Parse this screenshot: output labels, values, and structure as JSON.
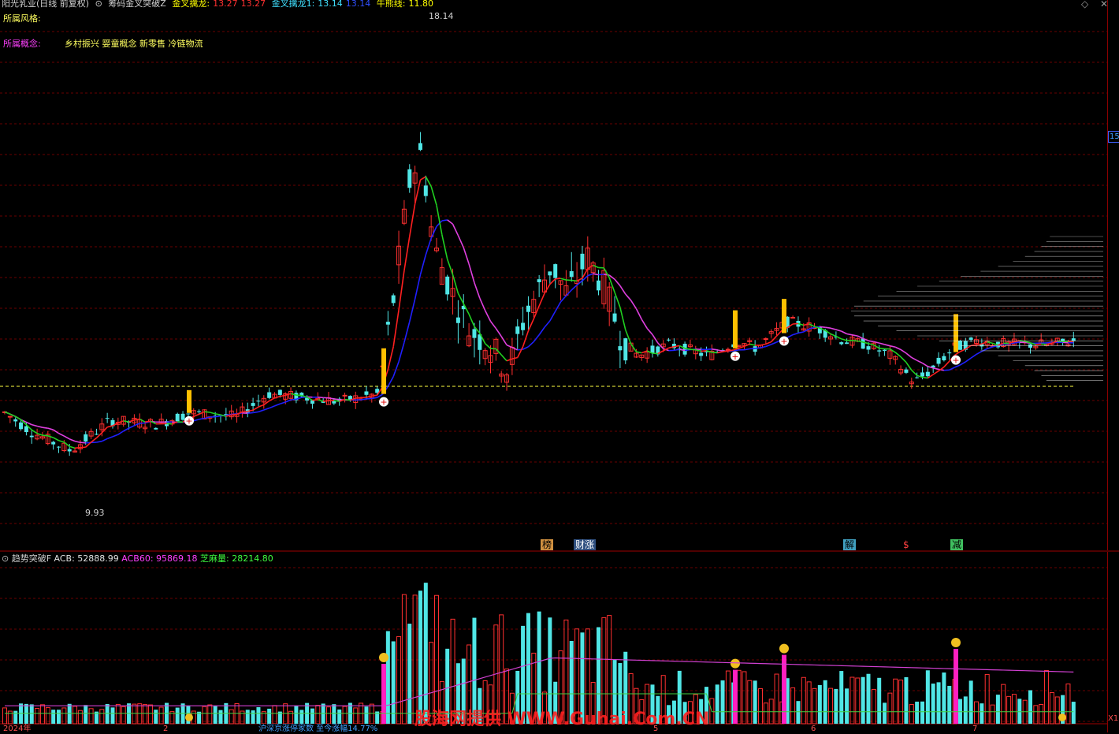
{
  "header": {
    "stock": "阳光乳业(日线 前复权)",
    "indicator": "筹码金叉突破Z",
    "s1_label": "金叉擒龙:",
    "s1_value": "13.27",
    "s1_value2": "13.27",
    "s2_label": "金叉擒龙1:",
    "s2_value": "13.14",
    "s2_value2": "13.14",
    "s3_label": "牛熊线:",
    "s3_value": "11.80",
    "colors": {
      "s1": "#ff3030",
      "s2": "#40e0ff",
      "s3": "#ffff00"
    }
  },
  "info": {
    "style_label": "所属风格:",
    "concept_label": "所属概念:",
    "concepts": "乡村振兴 婴童概念 新零售 冷链物流"
  },
  "price_labels": {
    "high": "18.14",
    "low": "9.93",
    "right_scale": "15"
  },
  "event_tags": [
    "榜",
    "财涨",
    "解",
    "$",
    "减"
  ],
  "lower_header": {
    "indicator": "趋势突破F",
    "acb": "ACB: 52888.99",
    "acb60": "ACB60: 95869.18",
    "zhima": "芝麻量: 28214.80"
  },
  "bottom_axis": {
    "year": "2024年",
    "m2": "2",
    "m5": "5",
    "m6": "6",
    "m7": "7",
    "status": "沪深京涨停家数 至今涨幅14.77%",
    "corner": "X1"
  },
  "watermark": "股海网提供 WWW.Guhai.Com.CN",
  "window_icons": [
    "restore-icon",
    "close-icon"
  ],
  "chart_data": {
    "type": "candlestick",
    "y_range": [
      9.2,
      18.6
    ],
    "high_label": 18.14,
    "low_label": 9.93,
    "bull_bear_line": 11.8,
    "colors": {
      "up": "#ff3030",
      "down": "#50e6e6",
      "ma_up": "#ff2020",
      "ma_down": "#20d020",
      "ma_long_up": "#2020ff",
      "ma_long_down": "#e040e0"
    }
  }
}
